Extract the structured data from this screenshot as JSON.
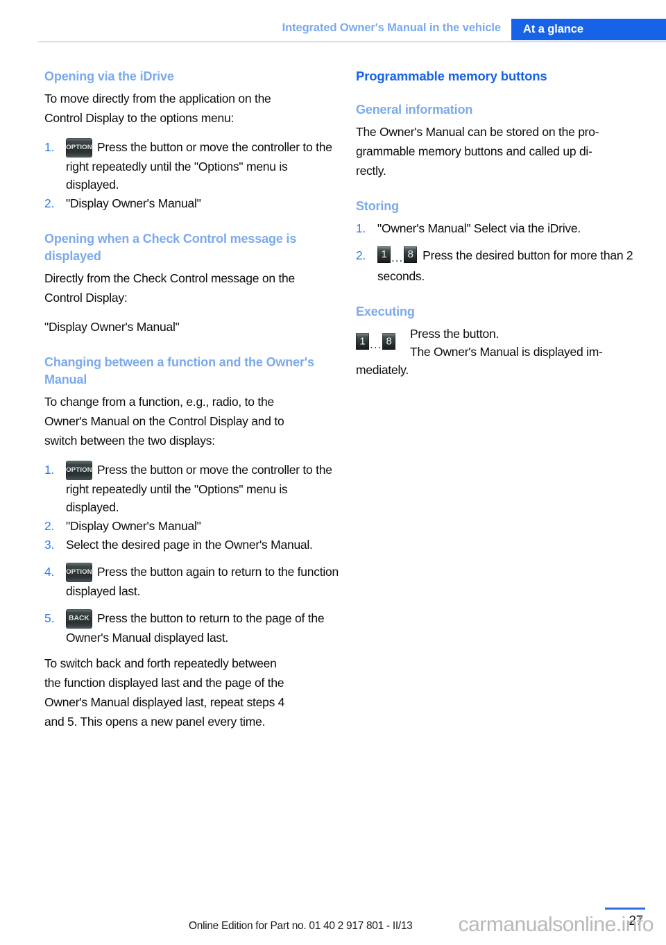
{
  "header": {
    "chapter": "Integrated Owner's Manual in the vehicle",
    "tab": "At a glance"
  },
  "left_column": {
    "section1": {
      "heading": "Opening via the iDrive",
      "intro_line1": "To move directly from the application on the",
      "intro_line2": "Control Display to the options menu:",
      "steps": [
        {
          "num": "1.",
          "icon": "OPTION",
          "text": "Press the button or move the controller to the right repeatedly until the \"Options\" menu is displayed."
        },
        {
          "num": "2.",
          "text": "\"Display Owner's Manual\""
        }
      ]
    },
    "section2": {
      "heading": "Opening when a Check Control message is displayed",
      "body_line1": "Directly from the Check Control message on the",
      "body_line2": "Control Display:",
      "body_line3": "\"Display Owner's Manual\""
    },
    "section3": {
      "heading": "Changing between a function and the Owner's Manual",
      "intro_line1": "To change from a function, e.g., radio, to the",
      "intro_line2": "Owner's Manual on the Control Display and to",
      "intro_line3": "switch between the two displays:",
      "steps": [
        {
          "num": "1.",
          "icon": "OPTION",
          "text": "Press the button or move the controller to the right repeatedly until the \"Options\" menu is displayed."
        },
        {
          "num": "2.",
          "text": "\"Display Owner's Manual\""
        },
        {
          "num": "3.",
          "text": "Select the desired page in the Owner's Manual."
        },
        {
          "num": "4.",
          "icon": "OPTION",
          "text": "Press the button again to return to the function displayed last."
        },
        {
          "num": "5.",
          "icon": "BACK",
          "text": "Press the button to return to the page of the Owner's Manual displayed last."
        }
      ],
      "outro_line1": "To switch back and forth repeatedly between",
      "outro_line2": "the function displayed last and the page of the",
      "outro_line3": "Owner's Manual displayed last, repeat steps 4",
      "outro_line4": "and 5. This opens a new panel every time."
    }
  },
  "right_column": {
    "title": "Programmable memory buttons",
    "general": {
      "heading": "General information",
      "body_line1": "The Owner's Manual can be stored on the pro-",
      "body_line2": "grammable memory buttons and called up di-",
      "body_line3": "rectly."
    },
    "storing": {
      "heading": "Storing",
      "steps": [
        {
          "num": "1.",
          "text": "\"Owner's Manual\" Select via the iDrive."
        },
        {
          "num": "2.",
          "mem_from": "1",
          "mem_dots": "...",
          "mem_to": "8",
          "text": "Press the desired button for more than 2 seconds."
        }
      ]
    },
    "executing": {
      "heading": "Executing",
      "mem_from": "1",
      "mem_dots": "...",
      "mem_to": "8",
      "line1": "Press the button.",
      "line2": "The Owner's Manual is displayed im-",
      "line3": "mediately."
    }
  },
  "footer": {
    "edition": "Online Edition for Part no. 01 40 2 917 801 - II/13",
    "page_number": "27",
    "watermark": "carmanualsonline.info"
  },
  "colors": {
    "accent_blue": "#1763e8",
    "light_blue": "#7aa9ee",
    "list_number_blue": "#2f7bec",
    "header_rule": "#cfe0f7"
  }
}
